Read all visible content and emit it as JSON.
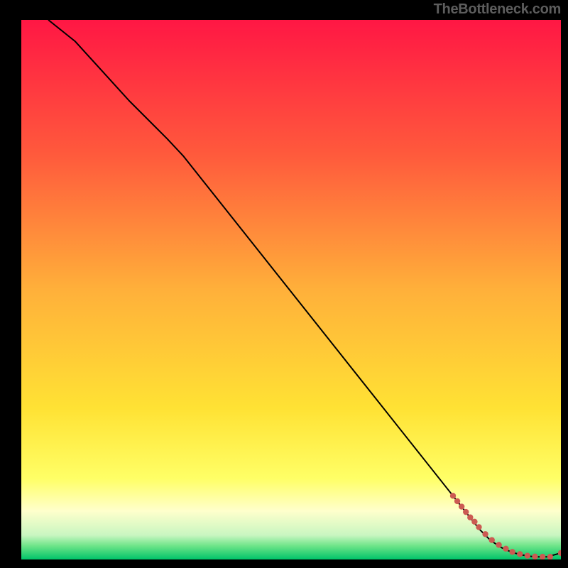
{
  "attribution": "TheBottleneck.com",
  "chart_data": {
    "type": "line",
    "title": "",
    "xlabel": "",
    "ylabel": "",
    "xlim": [
      0,
      100
    ],
    "ylim": [
      0,
      100
    ],
    "background_gradient": {
      "stops": [
        {
          "pos": 0.0,
          "color": "#ff1744"
        },
        {
          "pos": 0.25,
          "color": "#ff5a3c"
        },
        {
          "pos": 0.5,
          "color": "#ffb03a"
        },
        {
          "pos": 0.72,
          "color": "#ffe234"
        },
        {
          "pos": 0.85,
          "color": "#ffff66"
        },
        {
          "pos": 0.91,
          "color": "#ffffcc"
        },
        {
          "pos": 0.955,
          "color": "#c9f6c1"
        },
        {
          "pos": 0.975,
          "color": "#6de488"
        },
        {
          "pos": 1.0,
          "color": "#00c46a"
        }
      ]
    },
    "series": [
      {
        "name": "bottleneck-curve",
        "color": "#000000",
        "width": 2,
        "x": [
          5,
          10,
          15,
          20,
          25,
          27,
          30,
          35,
          40,
          45,
          50,
          55,
          60,
          65,
          70,
          75,
          80,
          83,
          85,
          87,
          89,
          91,
          93,
          95,
          97.5,
          100
        ],
        "y": [
          100,
          96,
          90.5,
          85,
          80,
          78,
          74.8,
          68.5,
          62.2,
          55.9,
          49.6,
          43.3,
          37.0,
          30.7,
          24.4,
          18.1,
          11.8,
          8.0,
          5.5,
          3.5,
          2.2,
          1.3,
          0.8,
          0.5,
          0.5,
          1.2
        ]
      }
    ],
    "points": {
      "name": "data-points",
      "color": "#cc5a52",
      "radius": 4.2,
      "x": [
        80.0,
        80.8,
        81.6,
        82.4,
        83.2,
        84.0,
        84.8,
        86.0,
        87.2,
        88.5,
        89.8,
        91.0,
        92.4,
        93.8,
        95.2,
        96.6,
        98.0,
        100.0
      ],
      "y": [
        11.8,
        10.8,
        9.8,
        8.8,
        7.8,
        7.0,
        6.0,
        4.7,
        3.6,
        2.7,
        2.0,
        1.4,
        1.0,
        0.7,
        0.55,
        0.5,
        0.5,
        1.2
      ]
    }
  }
}
